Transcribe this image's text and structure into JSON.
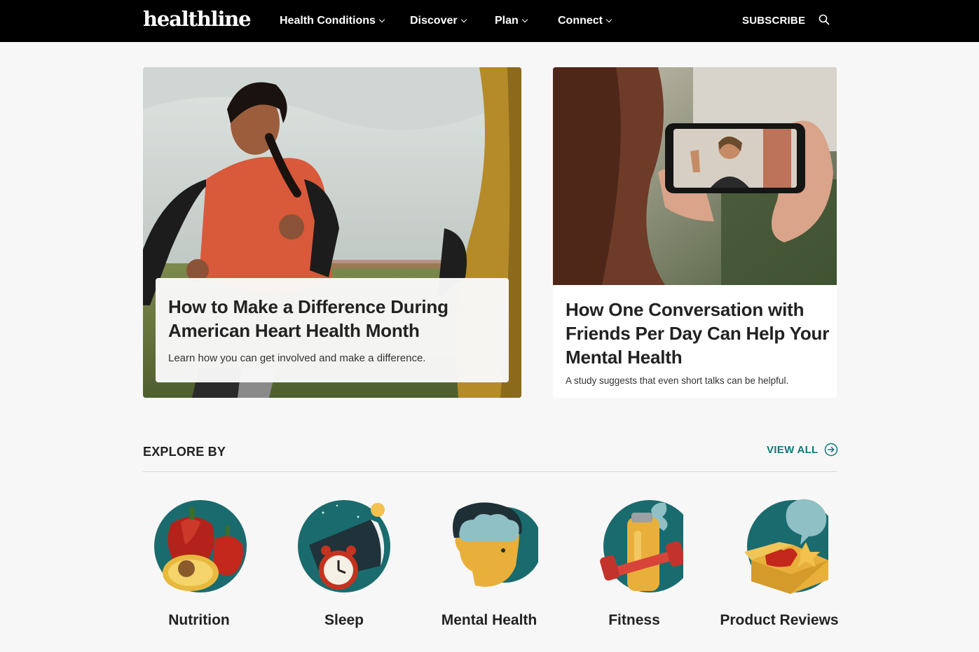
{
  "header": {
    "logo": "healthline",
    "nav": [
      {
        "label": "Health Conditions"
      },
      {
        "label": "Discover"
      },
      {
        "label": "Plan"
      },
      {
        "label": "Connect"
      }
    ],
    "subscribe": "SUBSCRIBE",
    "search_icon": "search-icon"
  },
  "featured": [
    {
      "title": "How to Make a Difference During American Heart Health Month",
      "description": "Learn how you can get involved and make a difference."
    },
    {
      "title": "How One Conversation with Friends Per Day Can Help Your Mental Health",
      "description": "A study suggests that even short talks can be helpful."
    }
  ],
  "explore": {
    "title": "EXPLORE BY",
    "view_all": "VIEW ALL",
    "categories": [
      {
        "label": "Nutrition",
        "icon": "nutrition-icon"
      },
      {
        "label": "Sleep",
        "icon": "sleep-icon"
      },
      {
        "label": "Mental Health",
        "icon": "mental-health-icon"
      },
      {
        "label": "Fitness",
        "icon": "fitness-icon"
      },
      {
        "label": "Product Reviews",
        "icon": "product-reviews-icon"
      }
    ]
  },
  "colors": {
    "header_bg": "#000000",
    "page_bg": "#f7f7f7",
    "accent_teal": "#0f7a7a",
    "icon_teal": "#1a6b6e"
  }
}
